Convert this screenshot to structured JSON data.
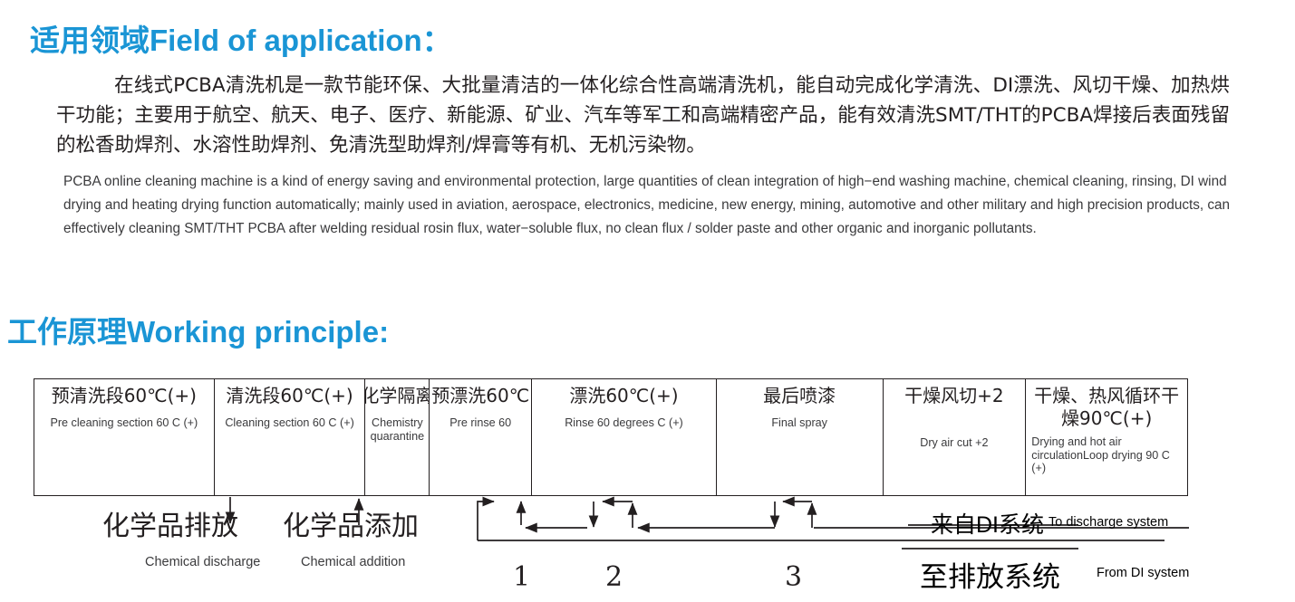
{
  "sections": {
    "field_of_application": {
      "heading": "适用领域Field of application：",
      "cn_text": "在线式PCBA清洗机是一款节能环保、大批量清洁的一体化综合性高端清洗机，能自动完成化学清洗、DI漂洗、风切干燥、加热烘干功能；主要用于航空、航天、电子、医疗、新能源、矿业、汽车等军工和高端精密产品，能有效清洗SMT/THT的PCBA焊接后表面残留的松香助焊剂、水溶性助焊剂、免清洗型助焊剂/焊膏等有机、无机污染物。",
      "en_text": "PCBA online cleaning machine is a kind of energy saving and environmental protection, large quantities of clean integration of high−end washing machine, chemical cleaning, rinsing, DI wind drying and heating drying function automatically; mainly used in aviation, aerospace, electronics, medicine, new energy, mining, automotive and other military and high precision products, can effectively cleaning SMT/THT PCBA after welding residual rosin flux, water−soluble flux, no clean flux / solder paste and other organic and inorganic pollutants."
    },
    "working_principle": {
      "heading": "工作原理Working principle:"
    }
  },
  "process_table": {
    "stages": [
      {
        "cn": "预清洗段60℃(+)",
        "en": "Pre cleaning section 60 C (+)"
      },
      {
        "cn": "清洗段60℃(+)",
        "en": "Cleaning section 60 C (+)"
      },
      {
        "cn": "化学隔离",
        "en": "Chemistry quarantine"
      },
      {
        "cn": "预漂洗60℃",
        "en": "Pre rinse 60"
      },
      {
        "cn": "漂洗60℃(+)",
        "en": "Rinse 60 degrees C (+)"
      },
      {
        "cn": "最后喷漆",
        "en": "Final spray"
      },
      {
        "cn": "干燥风切+2",
        "en": "Dry air cut +2"
      },
      {
        "cn": "干燥、热风循环干燥90℃(+)",
        "en": "Drying and hot air circulationLoop drying 90 C (+)"
      }
    ]
  },
  "diagram_labels": {
    "chemical_discharge_cn": "化学品排放",
    "chemical_discharge_en": "Chemical discharge",
    "chemical_addition_cn": "化学品添加",
    "chemical_addition_en": "Chemical addition",
    "from_di_cn": "来自DI系统",
    "from_di_en": "To discharge system",
    "to_discharge_cn": "至排放系统",
    "to_discharge_en": "From DI system",
    "step_numbers": [
      "1",
      "2",
      "3"
    ]
  },
  "colors": {
    "heading_blue": "#1a95d5",
    "body_text": "#231f20",
    "secondary_text": "#3a3a3c",
    "line": "#231f20"
  }
}
